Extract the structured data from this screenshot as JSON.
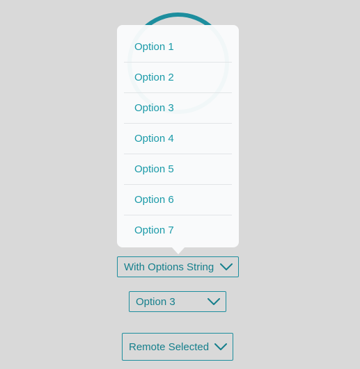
{
  "popover": {
    "options": [
      "Option 1",
      "Option 2",
      "Option 3",
      "Option 4",
      "Option 5",
      "Option 6",
      "Option 7"
    ]
  },
  "selects": {
    "options_string_label": "With Options String",
    "option3_label": "Option 3",
    "remote_selected_label": "Remote Selected"
  },
  "colors": {
    "accent": "#1a9aa8",
    "background": "#d9d9d9",
    "popover_bg": "#fafbfc"
  },
  "icons": {
    "dropdown": "chevron-down-icon"
  }
}
